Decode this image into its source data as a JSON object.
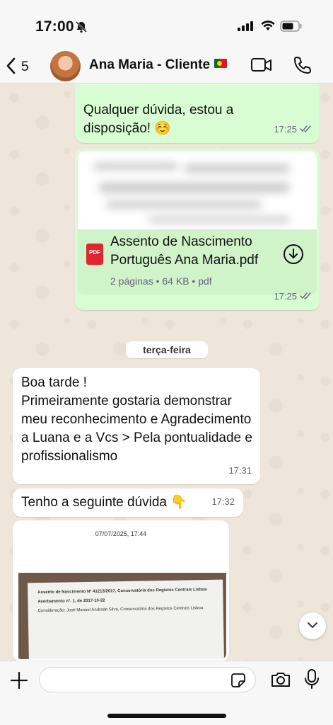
{
  "status_bar": {
    "time": "17:00"
  },
  "header": {
    "back_count": "5",
    "contact_name": "Ana Maria - Cliente"
  },
  "messages": {
    "m1": {
      "text": "Qualquer dúvida, estou a disposição! ☺️",
      "time": "17:25"
    },
    "m2": {
      "file_name": "Assento de Nascimento Português Ana Maria.pdf",
      "file_info": "2 páginas • 64 KB • pdf",
      "icon_label": "PDF",
      "time": "17:25"
    },
    "date_divider": "terça-feira",
    "m3": {
      "text": "Boa tarde !\nPrimeiramente gostaria demonstrar meu reconhecimento e Agradecimento a Luana e a Vcs > Pela pontualidade e profissionalismo",
      "time": "17:31"
    },
    "m4": {
      "text": "Tenho a seguinte dúvida 👇",
      "time": "17:32"
    },
    "m5": {
      "caption": "07/07/2025, 17:44",
      "doc_lines": [
        "Assento de Nascimento Nº 41213/2017, Conservatória dos Registos Centrais Lisboa",
        "Averbamento nº. 1, de 2017-10-22",
        "Consideração: José Manuel Andrade Silva, Conservatória dos Registos Centrais Lisboa"
      ]
    }
  },
  "composer": {
    "placeholder": ""
  },
  "colors": {
    "outgoing": "#d9fdd3",
    "incoming": "#ffffff",
    "tick_read": "#667788"
  }
}
